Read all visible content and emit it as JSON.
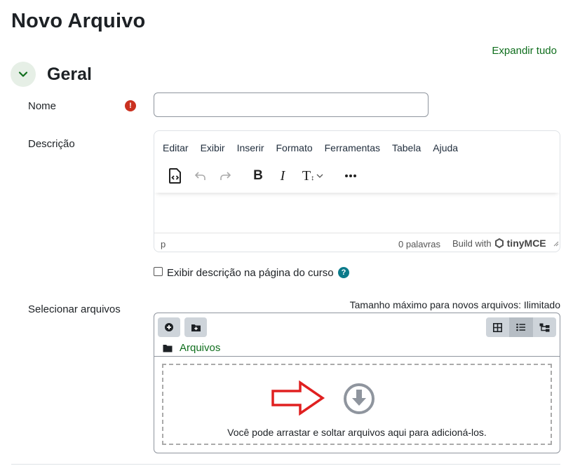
{
  "page": {
    "title": "Novo Arquivo",
    "expand_all": "Expandir tudo"
  },
  "section": {
    "title": "Geral"
  },
  "fields": {
    "name_label": "Nome",
    "name_value": "",
    "description_label": "Descrição",
    "show_description_label": "Exibir descrição na página do curso",
    "show_description_checked": false,
    "select_files_label": "Selecionar arquivos"
  },
  "editor": {
    "menu": [
      "Editar",
      "Exibir",
      "Inserir",
      "Formato",
      "Ferramentas",
      "Tabela",
      "Ajuda"
    ],
    "toolbar_icons": [
      "source-code-icon",
      "undo-icon",
      "redo-icon",
      "bold-icon",
      "italic-icon",
      "font-size-icon",
      "more-icon"
    ],
    "status_path": "p",
    "word_count": "0 palavras",
    "build_with": "Build with",
    "brand": "tinyMCE"
  },
  "filepicker": {
    "max_size": "Tamanho máximo para novos arquivos: Ilimitado",
    "breadcrumb": "Arquivos",
    "drop_text": "Você pode arrastar e soltar arquivos aqui para adicioná-los.",
    "active_view": "list"
  },
  "colors": {
    "brand_green": "#0f6e1d",
    "required_red": "#ca3120",
    "annotation_arrow_red": "#e02020"
  }
}
